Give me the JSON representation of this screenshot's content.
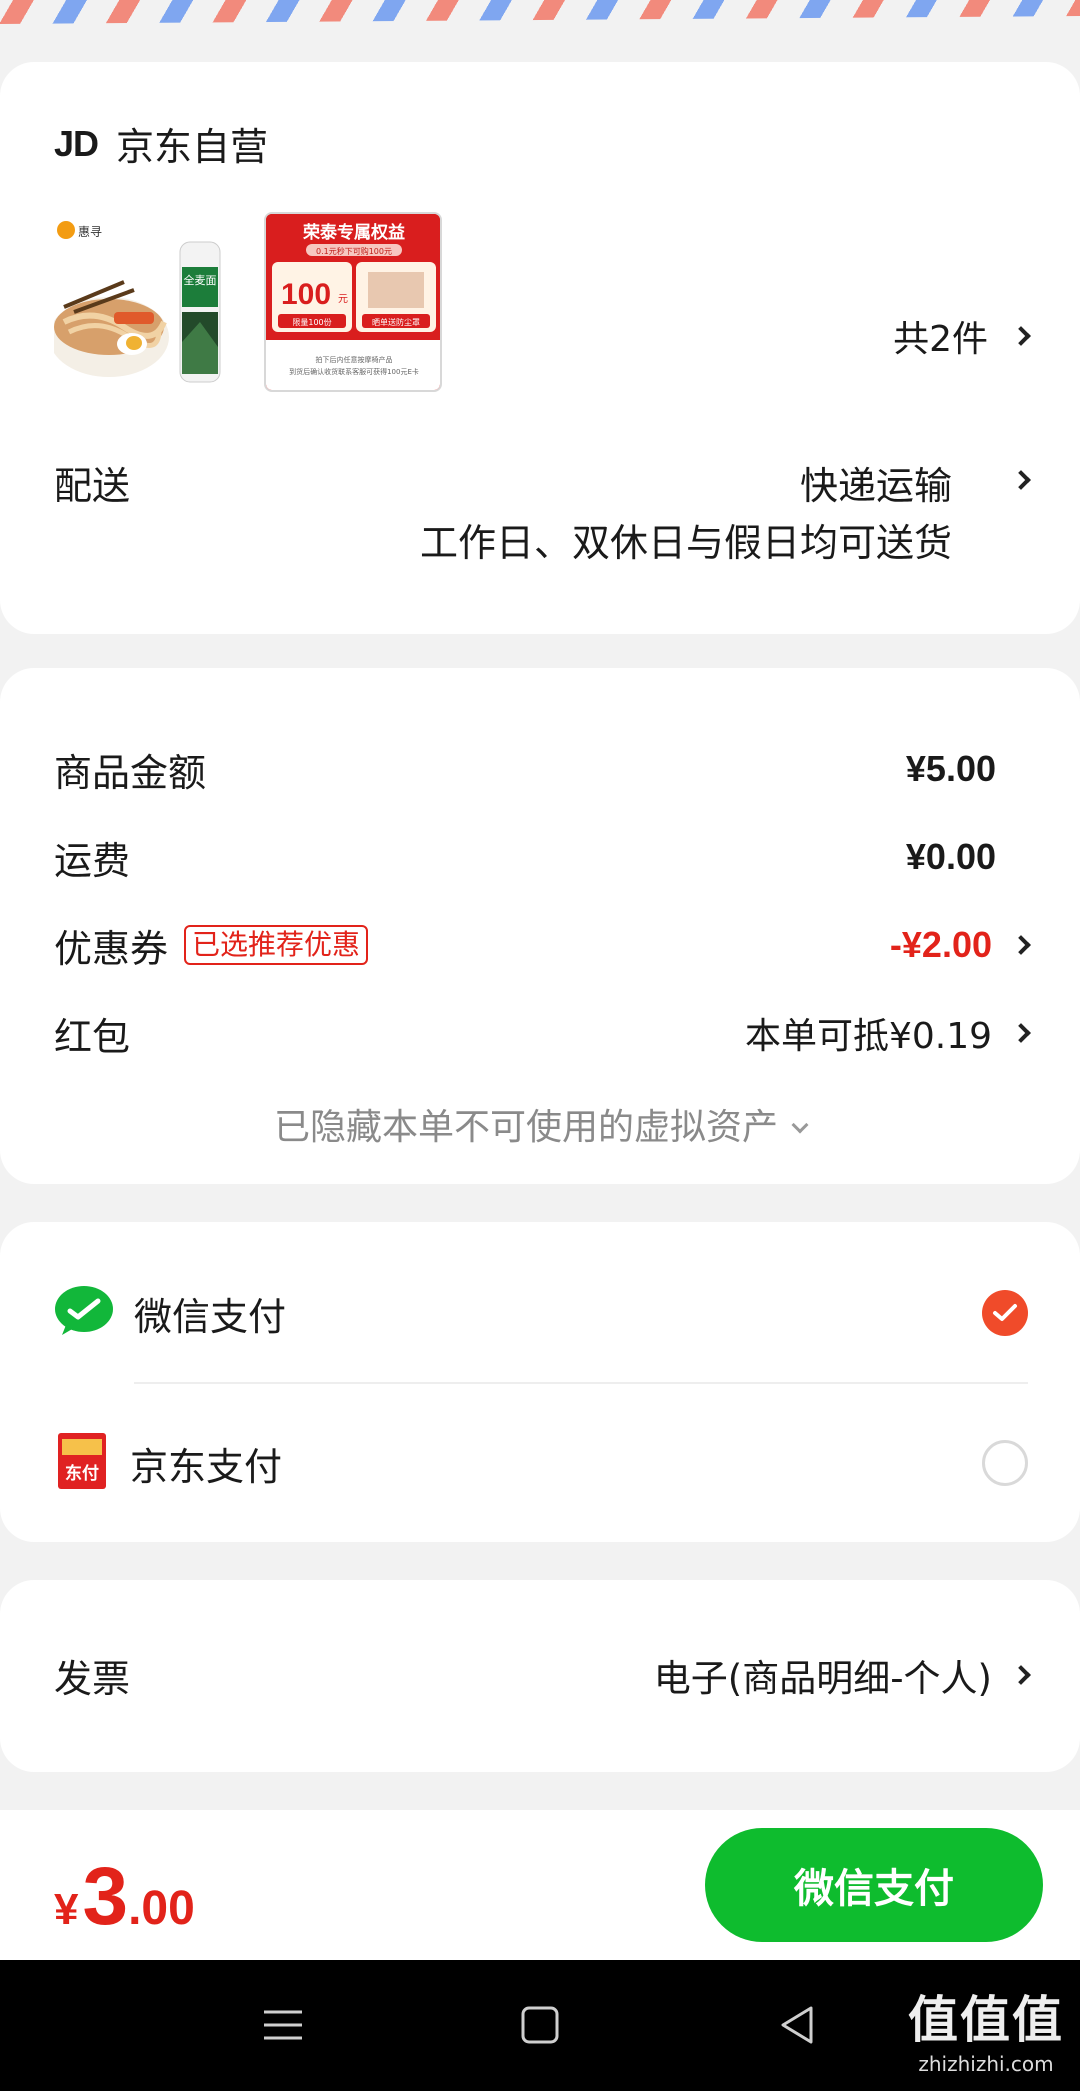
{
  "shop": {
    "logo": "JD",
    "name": "京东自营",
    "count_label": "共2件",
    "promo_title": "荣泰专属权益",
    "promo_sub": "0.1元秒下可购100元",
    "promo_amount": "100",
    "promo_unit": "元",
    "promo_limit": "限量100份",
    "promo_right": "晒单送防尘罩",
    "promo_footer_1": "拍下后内任意按摩椅产品",
    "promo_footer_2": "到货后确认收货联系客服可获得100元E卡",
    "noodle_brand": "惠寻",
    "noodle_pack": "全麦面"
  },
  "shipping": {
    "label": "配送",
    "method": "快递运输",
    "note": "工作日、双休日与假日均可送货"
  },
  "amounts": {
    "goods_label": "商品金额",
    "goods_value": "¥5.00",
    "freight_label": "运费",
    "freight_value": "¥0.00",
    "coupon_label": "优惠券",
    "coupon_tag": "已选推荐优惠",
    "coupon_value": "-¥2.00",
    "redpack_label": "红包",
    "redpack_value": "本单可抵¥0.19",
    "hidden_assets": "已隐藏本单不可使用的虚拟资产"
  },
  "payment": {
    "wechat_label": "微信支付",
    "wechat_selected": true,
    "jdpay_label": "京东支付",
    "jdpay_icon_text": "东付",
    "jdpay_selected": false
  },
  "invoice": {
    "label": "发票",
    "value": "电子(商品明细-个人)"
  },
  "footer": {
    "currency": "¥",
    "total_int": "3",
    "total_dec": ".00",
    "pay_button": "微信支付"
  },
  "watermark": {
    "main": "值值值",
    "url": "zhizhizhi.com"
  },
  "colors": {
    "accent_red": "#e2231a",
    "wechat_green": "#0ebc2e",
    "radio_selected": "#f04b2a"
  }
}
